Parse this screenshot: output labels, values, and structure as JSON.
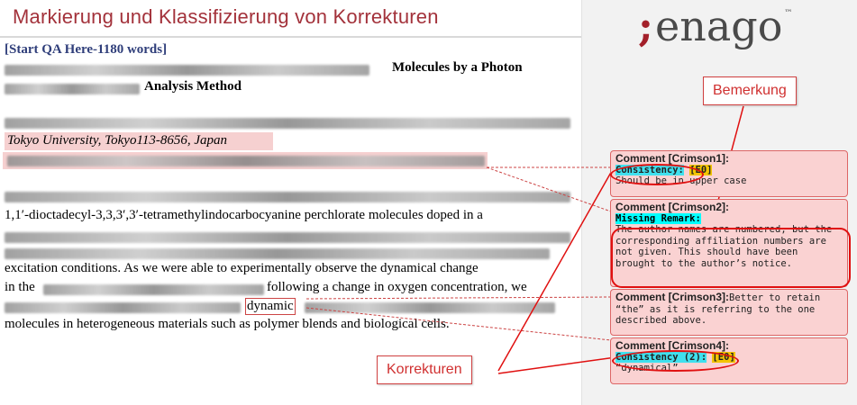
{
  "header": {
    "title": "Markierung und Klassifizierung von Korrekturen"
  },
  "logo": {
    "mark": ";",
    "text": "enago",
    "tm": "™"
  },
  "document": {
    "qa_label": "[Start QA Here-1180 words]",
    "title_part1": "Molecules by a Photon",
    "title_part2": "Analysis Method",
    "affiliation": "Tokyo University, Tokyo113-8656, Japan",
    "para_line2": "1,1′-dioctadecyl-3,3,3′,3′-tetramethylindocarbocyanine perchlorate molecules doped in a",
    "para_line5": "excitation conditions.  As we were able to experimentally observe the dynamical change",
    "para_line6_a": "in the",
    "para_line6_b": "following a change in oxygen concentration, we",
    "para_line7_word": "dynamic",
    "para_line8": "molecules in heterogeneous materials such as polymer blends and biological cells."
  },
  "comments": [
    {
      "title": "Comment [Crimson1]:",
      "tag": "Consistency:",
      "code": "[E0]",
      "body": "Should be in upper case"
    },
    {
      "title": "Comment [Crimson2]:",
      "tag": "Missing Remark:",
      "body": "The author names are numbered, but the corresponding affiliation numbers are not given. This should have been brought to the author’s notice."
    },
    {
      "title": "Comment [Crimson3]:",
      "inline": "Better to retain “the” as it is referring to the one described above."
    },
    {
      "title": "Comment [Crimson4]:",
      "tag": "Consistency (2):",
      "code": "[E0]",
      "body": "“dynamical”"
    }
  ],
  "callouts": {
    "bemerkung": "Bemerkung",
    "korrekturen": "Korrekturen"
  },
  "colors": {
    "title_red": "#a3323b",
    "comment_bg": "#fad2d2",
    "callout_red": "#e01010",
    "tag_cyan": "#3fe0ee",
    "tag_yellow": "#f3c500"
  }
}
